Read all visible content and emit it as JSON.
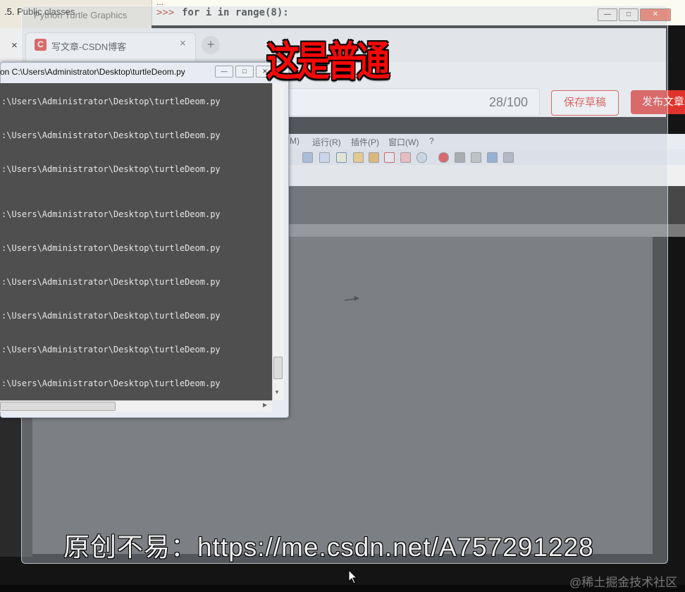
{
  "shell": {
    "left_title": ".5. Public classes",
    "ellipsis": "...",
    "prompt": ">>>",
    "code": "for i in range(8):"
  },
  "turtle_window": {
    "title": "Python Turtle Graphics",
    "controls": [
      "—",
      "□",
      "✕"
    ]
  },
  "browser": {
    "left_tab_close": "×",
    "tab_logo": "C",
    "tab_title": "写文章-CSDN博客",
    "tab_close": "×",
    "new_tab": "+",
    "char_count": "28/100",
    "save_draft": "保存草稿",
    "publish": "发布文章"
  },
  "editor": {
    "menu": [
      "M)",
      "运行(R)",
      "插件(P)",
      "窗口(W)",
      "?"
    ]
  },
  "console": {
    "title": "on  C:\\Users\\Administrator\\Desktop\\turtleDeom.py",
    "controls": [
      "—",
      "□",
      "✕"
    ],
    "lines": [
      ":\\Users\\Administrator\\Desktop\\turtleDeom.py",
      ":\\Users\\Administrator\\Desktop\\turtleDeom.py",
      ":\\Users\\Administrator\\Desktop\\turtleDeom.py",
      ":\\Users\\Administrator\\Desktop\\turtleDeom.py",
      ":\\Users\\Administrator\\Desktop\\turtleDeom.py",
      ":\\Users\\Administrator\\Desktop\\turtleDeom.py",
      ":\\Users\\Administrator\\Desktop\\turtleDeom.py",
      ":\\Users\\Administrator\\Desktop\\turtleDeom.py",
      ":\\Users\\Administrator\\Desktop\\turtleDeom.py"
    ],
    "scroll_down": "▼",
    "scroll_right": "▶"
  },
  "overlay": {
    "caption": "这是普通",
    "url_banner": "原创不易：https://me.csdn.net/A757291228",
    "watermark": "@稀土掘金技术社区"
  },
  "colors": {
    "csdn_red": "#e0332b",
    "caption_red": "#f40808",
    "console_bg": "#4f4f4f",
    "canvas_bg": "#535353"
  }
}
